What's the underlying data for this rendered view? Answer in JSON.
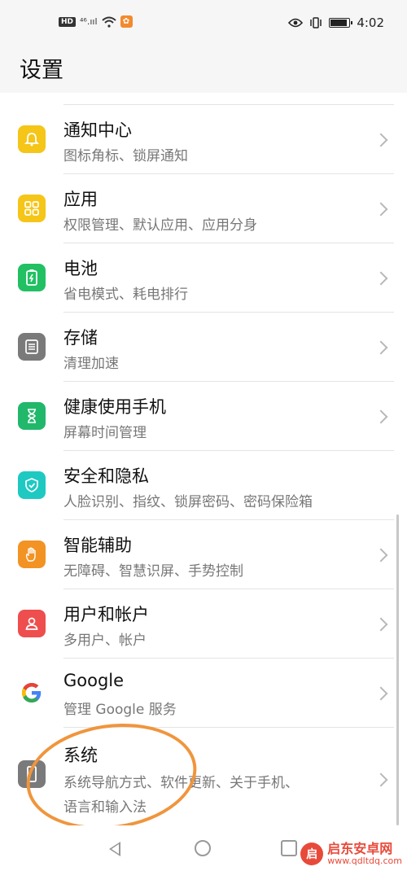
{
  "status_bar": {
    "hd": "HD",
    "signal": "⁴⁶.ııl",
    "time": "4:02",
    "icons": [
      "hd-icon",
      "signal-icon",
      "wifi-icon",
      "app-notification-icon",
      "eye-icon",
      "vibrate-icon",
      "battery-icon"
    ]
  },
  "header": {
    "title": "设置"
  },
  "settings": {
    "items": [
      {
        "label": "通知中心",
        "sub": "图标角标、锁屏通知",
        "icon": "bell-icon",
        "color": "#f5c518"
      },
      {
        "label": "应用",
        "sub": "权限管理、默认应用、应用分身",
        "icon": "apps-grid-icon",
        "color": "#f5c518"
      },
      {
        "label": "电池",
        "sub": "省电模式、耗电排行",
        "icon": "battery-icon",
        "color": "#21c063"
      },
      {
        "label": "存储",
        "sub": "清理加速",
        "icon": "storage-icon",
        "color": "#7a7a7a"
      },
      {
        "label": "健康使用手机",
        "sub": "屏幕时间管理",
        "icon": "hourglass-icon",
        "color": "#21b86b"
      },
      {
        "label": "安全和隐私",
        "sub": "人脸识别、指纹、锁屏密码、密码保险箱",
        "icon": "shield-icon",
        "color": "#1ec9c2"
      },
      {
        "label": "智能辅助",
        "sub": "无障碍、智慧识屏、手势控制",
        "icon": "hand-icon",
        "color": "#f29324"
      },
      {
        "label": "用户和帐户",
        "sub": "多用户、帐户",
        "icon": "user-icon",
        "color": "#ee4e4e"
      },
      {
        "label": "Google",
        "sub": "管理 Google 服务",
        "icon": "google-icon",
        "color": "#ffffff"
      },
      {
        "label": "系统",
        "sub": "系统导航方式、软件更新、关于手机、",
        "sub2": "语言和输入法",
        "icon": "system-phone-icon",
        "color": "#7a7a7a"
      }
    ]
  },
  "watermark": {
    "name": "启东安卓网",
    "url": "www.qdltdq.com",
    "logo_char": "启"
  }
}
